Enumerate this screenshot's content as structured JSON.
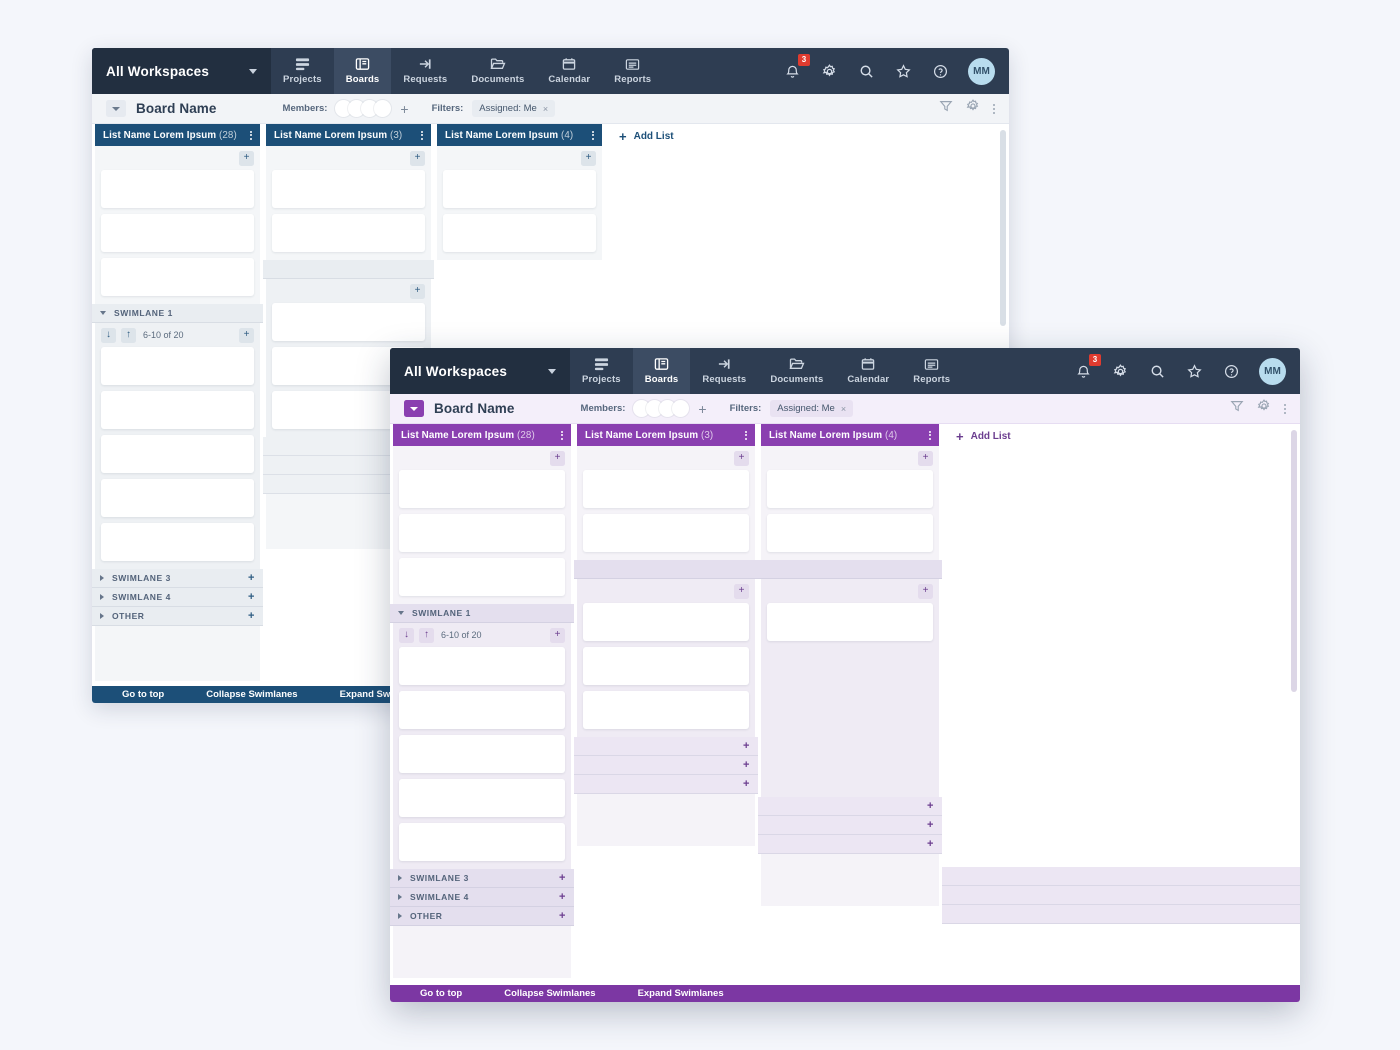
{
  "theme": {
    "back_accent": "#1c4f78",
    "front_accent": "#8a3fb0",
    "nav_bg": "#2e3d52",
    "badge_color": "#e03b2f",
    "page_bg": "#f4f6fb"
  },
  "nav": {
    "workspace_label": "All Workspaces",
    "items": [
      {
        "label": "Projects",
        "icon": "projects-icon",
        "active": false
      },
      {
        "label": "Boards",
        "icon": "boards-icon",
        "active": true
      },
      {
        "label": "Requests",
        "icon": "requests-icon",
        "active": false
      },
      {
        "label": "Documents",
        "icon": "documents-icon",
        "active": false
      },
      {
        "label": "Calendar",
        "icon": "calendar-icon",
        "active": false
      },
      {
        "label": "Reports",
        "icon": "reports-icon",
        "active": false
      }
    ],
    "notification_count": "3",
    "avatar_initials": "MM"
  },
  "board": {
    "title": "Board Name",
    "members_label": "Members:",
    "member_count": 4,
    "add_member_label": "+",
    "filters_label": "Filters:",
    "filter_chip": "Assigned: Me",
    "filter_chip_remove": "×"
  },
  "lists": [
    {
      "name": "List Name Lorem Ipsum",
      "count": "(28)",
      "top_cards": 3,
      "lane1_cards": 5
    },
    {
      "name": "List Name Lorem Ipsum",
      "count": "(3)",
      "top_cards": 2,
      "lane1_cards": 3
    },
    {
      "name": "List Name Lorem Ipsum",
      "count": "(4)",
      "top_cards": 2,
      "lane1_cards": 1
    }
  ],
  "add_list_label": "Add List",
  "pager": {
    "text": "6-10 of 20",
    "down_glyph": "↓",
    "up_glyph": "↑",
    "add_glyph": "+"
  },
  "swimlanes": [
    {
      "label": "SWIMLANE 1",
      "expanded": true
    },
    {
      "label": "SWIMLANE 3",
      "expanded": false
    },
    {
      "label": "SWIMLANE 4",
      "expanded": false
    },
    {
      "label": "OTHER",
      "expanded": false
    }
  ],
  "bottom_bar": {
    "go_to_top": "Go to top",
    "collapse": "Collapse Swimlanes",
    "expand": "Expand Swimlanes"
  }
}
